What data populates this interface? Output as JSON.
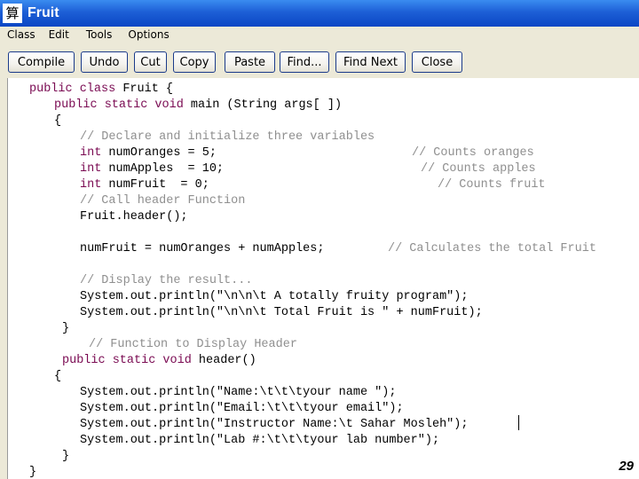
{
  "window": {
    "title": "Fruit",
    "icon": "abacus-icon"
  },
  "menu": {
    "items": [
      "Class",
      "Edit",
      "Tools",
      "Options"
    ]
  },
  "toolbar": {
    "buttons": [
      "Compile",
      "Undo",
      "Cut",
      "Copy",
      "Paste",
      "Find...",
      "Find Next",
      "Close"
    ]
  },
  "code": {
    "lines": [
      {
        "k": "public class",
        "r": " Fruit {"
      },
      {
        "k": "public static void",
        "r": " main (String args[ ])"
      },
      {
        "r": "{"
      },
      {
        "c": "// Declare and initialize three variables"
      },
      {
        "k": "int",
        "r": " numOranges = 5;",
        "c": "// Counts oranges"
      },
      {
        "k": "int",
        "r": " numApples  = 10;",
        "c": "// Counts apples"
      },
      {
        "k": "int",
        "r": " numFruit  = 0;",
        "c": "// Counts fruit"
      },
      {
        "c": "// Call header Function"
      },
      {
        "r": "Fruit.header();"
      },
      {
        "r": "numFruit = numOranges + numApples;",
        "c": "// Calculates the total Fruit"
      },
      {
        "c": "// Display the result..."
      },
      {
        "r": "System.out.println(\"\\n\\n\\t A totally fruity program\");"
      },
      {
        "r": "System.out.println(\"\\n\\n\\t Total Fruit is \" + numFruit);"
      },
      {
        "r": "}"
      },
      {
        "c": "// Function to Display Header"
      },
      {
        "k": "public static void",
        "r": " header()"
      },
      {
        "r": "{"
      },
      {
        "r": "System.out.println(\"Name:\\t\\t\\tyour name \");"
      },
      {
        "r": "System.out.println(\"Email:\\t\\t\\tyour email\");"
      },
      {
        "r": "System.out.println(\"Instructor Name:\\t Sahar Mosleh\");"
      },
      {
        "r": "System.out.println(\"Lab #:\\t\\t\\tyour lab number\");"
      },
      {
        "r": "}"
      },
      {
        "r": "}"
      }
    ]
  },
  "colors": {
    "titlebar": "#0a46c4",
    "keyword": "#7a0a52",
    "comment": "#8f8f8f",
    "chrome": "#ece9d8"
  },
  "slide_number": "29"
}
